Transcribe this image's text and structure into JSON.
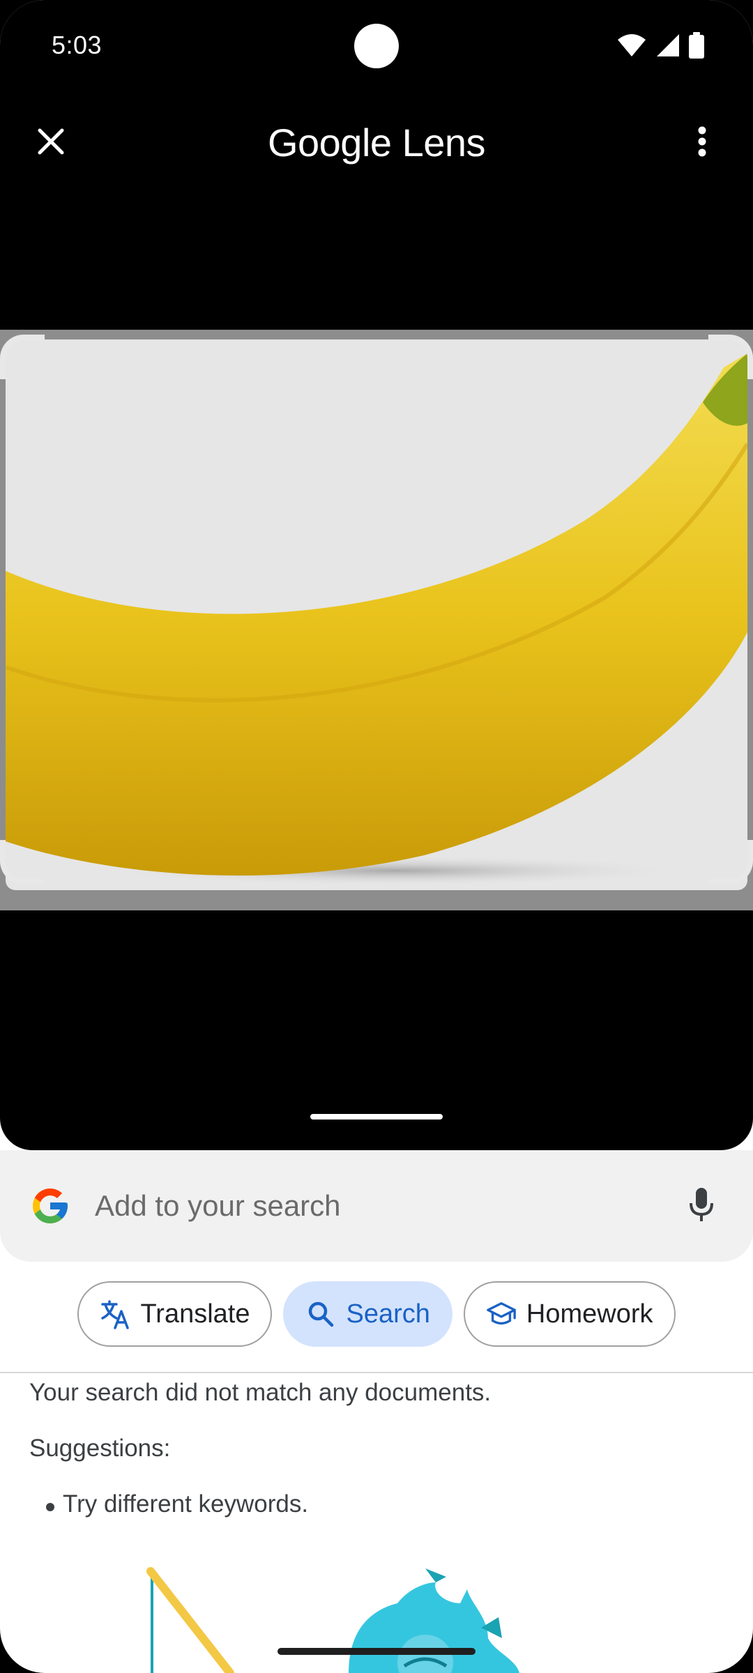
{
  "status_bar": {
    "time": "5:03",
    "icons": [
      "wifi-icon",
      "signal-icon",
      "battery-icon"
    ]
  },
  "app_bar": {
    "title": "Google Lens",
    "close_icon": "close-icon",
    "menu_icon": "more-vert-icon"
  },
  "viewer": {
    "image_subject": "banana",
    "handle_icon": "drag-handle"
  },
  "search": {
    "placeholder": "Add to your search",
    "value": "",
    "logo": "google-g-icon",
    "mic_icon": "mic-icon"
  },
  "chips": [
    {
      "label": "Translate",
      "icon": "translate-icon",
      "selected": false
    },
    {
      "label": "Search",
      "icon": "search-icon",
      "selected": true
    },
    {
      "label": "Homework",
      "icon": "school-icon",
      "selected": false
    }
  ],
  "results": {
    "no_match": "Your search did not match any documents.",
    "suggestions_label": "Suggestions:",
    "suggestions": [
      "Try different keywords."
    ]
  },
  "colors": {
    "accent": "#1a62c5",
    "chip_selected_bg": "#d3e3fd",
    "banana_yellow": "#e8c21a"
  }
}
